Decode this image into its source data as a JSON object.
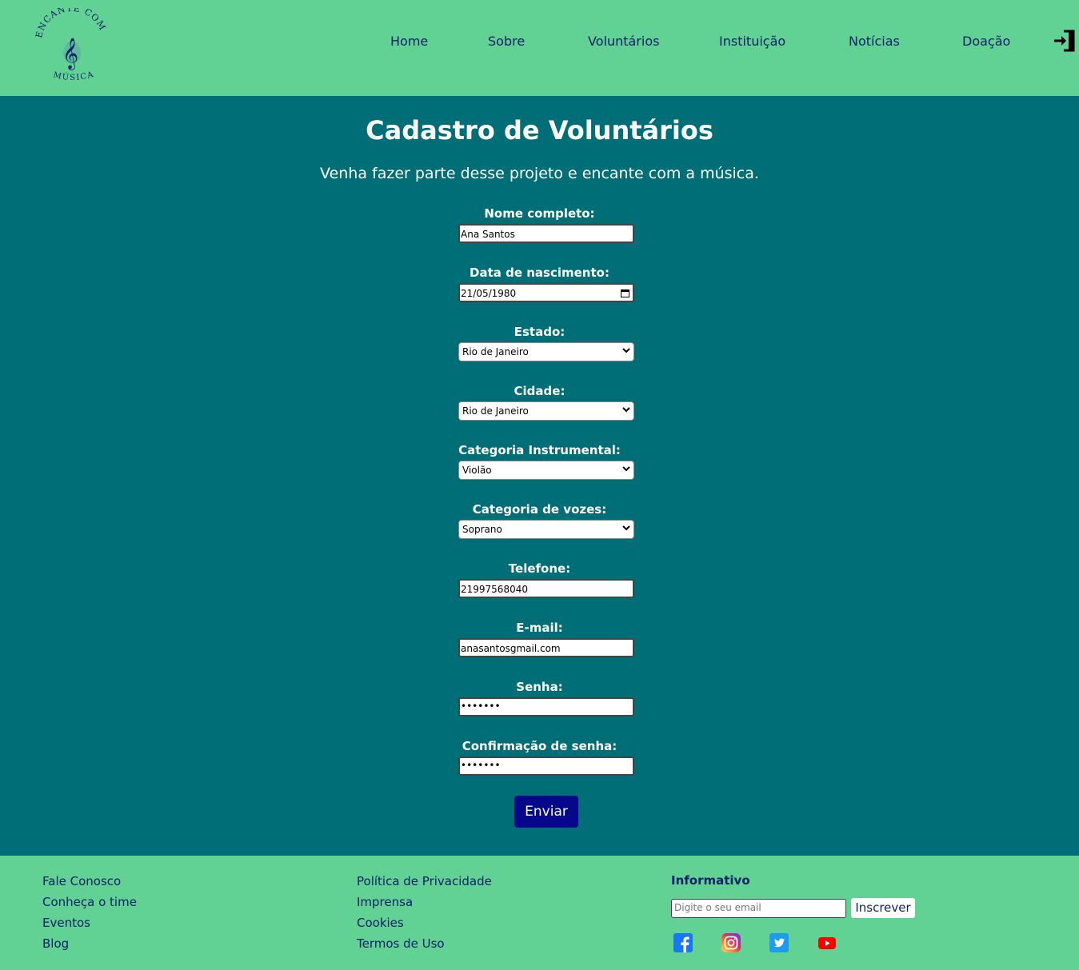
{
  "header": {
    "logo": {
      "top_text": "ENCANTE COM",
      "bottom_text": "MÚSICA",
      "icon": "treble-clef-icon"
    },
    "nav": [
      "Home",
      "Sobre",
      "Voluntários",
      "Instituição",
      "Notícias",
      "Doação"
    ],
    "login_icon": "login-icon"
  },
  "main": {
    "title": "Cadastro de Voluntários",
    "subtitle": "Venha fazer parte desse projeto e encante com a música.",
    "fields": {
      "nome": {
        "label": "Nome completo:",
        "value": "Ana Santos"
      },
      "nascimento": {
        "label": "Data de nascimento:",
        "value": "21/05/1980"
      },
      "estado": {
        "label": "Estado:",
        "value": "Rio de Janeiro"
      },
      "cidade": {
        "label": "Cidade:",
        "value": "Rio de Janeiro"
      },
      "instrumento": {
        "label": "Categoria Instrumental:",
        "value": "Violão"
      },
      "vozes": {
        "label": "Categoria de vozes:",
        "value": "Soprano"
      },
      "telefone": {
        "label": "Telefone:",
        "value": "21997568040"
      },
      "email": {
        "label": "E-mail:",
        "value": "anasantosgmail.com"
      },
      "senha": {
        "label": "Senha:",
        "value": "•••••••"
      },
      "confirmacao": {
        "label": "Confirmação de senha:",
        "value": "•••••••"
      }
    },
    "submit_label": "Enviar"
  },
  "footer": {
    "col1": [
      "Fale Conosco",
      "Conheça o time",
      "Eventos",
      "Blog"
    ],
    "col2": [
      "Política de Privacidade",
      "Imprensa",
      "Cookies",
      "Termos de Uso"
    ],
    "newsletter": {
      "title": "Informativo",
      "placeholder": "Digite o seu email",
      "button": "Inscrever"
    },
    "social": [
      "facebook-icon",
      "instagram-icon",
      "twitter-icon",
      "youtube-icon"
    ]
  },
  "colors": {
    "header_bg": "#62d194",
    "main_bg": "#006e76",
    "nav_text": "#0a1f6b",
    "button_bg": "#06078a"
  }
}
